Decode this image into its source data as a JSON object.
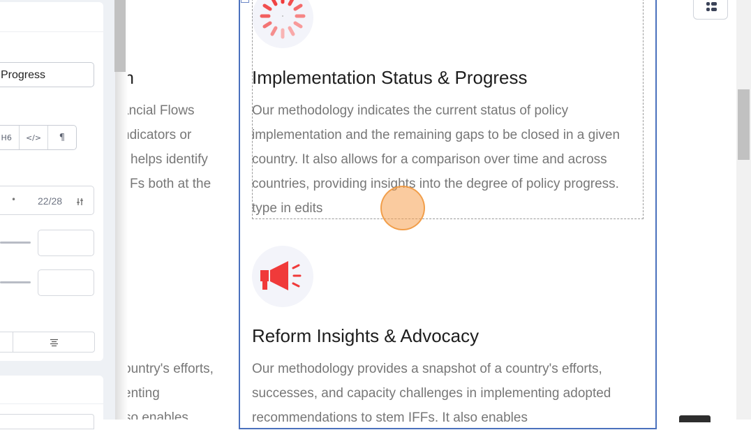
{
  "editor_panel": {
    "title_field_value": "Progress",
    "format_buttons": [
      "H6",
      "</>",
      "¶"
    ],
    "char_counter": "22/28"
  },
  "left_column": {
    "heading_fragment": "n",
    "para1": [
      "ancial Flows",
      "ndicators or",
      "helps identify",
      "Fs both at the"
    ],
    "para2": [
      "ountry's efforts,",
      "enting",
      "so enables"
    ]
  },
  "items": [
    {
      "icon": "loading-spinner-icon",
      "title": "Implementation Status & Progress",
      "description": "Our methodology indicates the current status of policy implementation and the remaining gaps to be closed in a given country. It also allows for a comparison over time and across countries, providing insights into the degree of policy progress.  type in edits"
    },
    {
      "icon": "megaphone-icon",
      "title": "Reform Insights & Advocacy",
      "description": "Our methodology provides a snapshot of a country's efforts, successes, and capacity challenges in implementing adopted recommendations to stem IFFs. It also enables"
    }
  ],
  "colors": {
    "accent_red": "#f03a3a",
    "selection_border": "#4a70bd"
  }
}
